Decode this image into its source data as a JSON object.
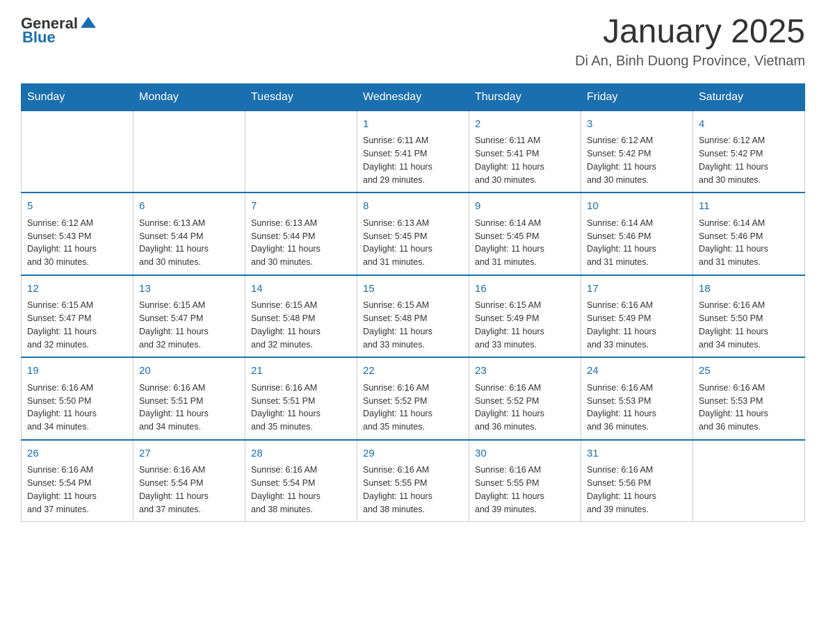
{
  "header": {
    "logo_general": "General",
    "logo_blue": "Blue",
    "month_title": "January 2025",
    "location": "Di An, Binh Duong Province, Vietnam"
  },
  "weekdays": [
    "Sunday",
    "Monday",
    "Tuesday",
    "Wednesday",
    "Thursday",
    "Friday",
    "Saturday"
  ],
  "weeks": [
    [
      {
        "day": "",
        "info": ""
      },
      {
        "day": "",
        "info": ""
      },
      {
        "day": "",
        "info": ""
      },
      {
        "day": "1",
        "info": "Sunrise: 6:11 AM\nSunset: 5:41 PM\nDaylight: 11 hours\nand 29 minutes."
      },
      {
        "day": "2",
        "info": "Sunrise: 6:11 AM\nSunset: 5:41 PM\nDaylight: 11 hours\nand 30 minutes."
      },
      {
        "day": "3",
        "info": "Sunrise: 6:12 AM\nSunset: 5:42 PM\nDaylight: 11 hours\nand 30 minutes."
      },
      {
        "day": "4",
        "info": "Sunrise: 6:12 AM\nSunset: 5:42 PM\nDaylight: 11 hours\nand 30 minutes."
      }
    ],
    [
      {
        "day": "5",
        "info": "Sunrise: 6:12 AM\nSunset: 5:43 PM\nDaylight: 11 hours\nand 30 minutes."
      },
      {
        "day": "6",
        "info": "Sunrise: 6:13 AM\nSunset: 5:44 PM\nDaylight: 11 hours\nand 30 minutes."
      },
      {
        "day": "7",
        "info": "Sunrise: 6:13 AM\nSunset: 5:44 PM\nDaylight: 11 hours\nand 30 minutes."
      },
      {
        "day": "8",
        "info": "Sunrise: 6:13 AM\nSunset: 5:45 PM\nDaylight: 11 hours\nand 31 minutes."
      },
      {
        "day": "9",
        "info": "Sunrise: 6:14 AM\nSunset: 5:45 PM\nDaylight: 11 hours\nand 31 minutes."
      },
      {
        "day": "10",
        "info": "Sunrise: 6:14 AM\nSunset: 5:46 PM\nDaylight: 11 hours\nand 31 minutes."
      },
      {
        "day": "11",
        "info": "Sunrise: 6:14 AM\nSunset: 5:46 PM\nDaylight: 11 hours\nand 31 minutes."
      }
    ],
    [
      {
        "day": "12",
        "info": "Sunrise: 6:15 AM\nSunset: 5:47 PM\nDaylight: 11 hours\nand 32 minutes."
      },
      {
        "day": "13",
        "info": "Sunrise: 6:15 AM\nSunset: 5:47 PM\nDaylight: 11 hours\nand 32 minutes."
      },
      {
        "day": "14",
        "info": "Sunrise: 6:15 AM\nSunset: 5:48 PM\nDaylight: 11 hours\nand 32 minutes."
      },
      {
        "day": "15",
        "info": "Sunrise: 6:15 AM\nSunset: 5:48 PM\nDaylight: 11 hours\nand 33 minutes."
      },
      {
        "day": "16",
        "info": "Sunrise: 6:15 AM\nSunset: 5:49 PM\nDaylight: 11 hours\nand 33 minutes."
      },
      {
        "day": "17",
        "info": "Sunrise: 6:16 AM\nSunset: 5:49 PM\nDaylight: 11 hours\nand 33 minutes."
      },
      {
        "day": "18",
        "info": "Sunrise: 6:16 AM\nSunset: 5:50 PM\nDaylight: 11 hours\nand 34 minutes."
      }
    ],
    [
      {
        "day": "19",
        "info": "Sunrise: 6:16 AM\nSunset: 5:50 PM\nDaylight: 11 hours\nand 34 minutes."
      },
      {
        "day": "20",
        "info": "Sunrise: 6:16 AM\nSunset: 5:51 PM\nDaylight: 11 hours\nand 34 minutes."
      },
      {
        "day": "21",
        "info": "Sunrise: 6:16 AM\nSunset: 5:51 PM\nDaylight: 11 hours\nand 35 minutes."
      },
      {
        "day": "22",
        "info": "Sunrise: 6:16 AM\nSunset: 5:52 PM\nDaylight: 11 hours\nand 35 minutes."
      },
      {
        "day": "23",
        "info": "Sunrise: 6:16 AM\nSunset: 5:52 PM\nDaylight: 11 hours\nand 36 minutes."
      },
      {
        "day": "24",
        "info": "Sunrise: 6:16 AM\nSunset: 5:53 PM\nDaylight: 11 hours\nand 36 minutes."
      },
      {
        "day": "25",
        "info": "Sunrise: 6:16 AM\nSunset: 5:53 PM\nDaylight: 11 hours\nand 36 minutes."
      }
    ],
    [
      {
        "day": "26",
        "info": "Sunrise: 6:16 AM\nSunset: 5:54 PM\nDaylight: 11 hours\nand 37 minutes."
      },
      {
        "day": "27",
        "info": "Sunrise: 6:16 AM\nSunset: 5:54 PM\nDaylight: 11 hours\nand 37 minutes."
      },
      {
        "day": "28",
        "info": "Sunrise: 6:16 AM\nSunset: 5:54 PM\nDaylight: 11 hours\nand 38 minutes."
      },
      {
        "day": "29",
        "info": "Sunrise: 6:16 AM\nSunset: 5:55 PM\nDaylight: 11 hours\nand 38 minutes."
      },
      {
        "day": "30",
        "info": "Sunrise: 6:16 AM\nSunset: 5:55 PM\nDaylight: 11 hours\nand 39 minutes."
      },
      {
        "day": "31",
        "info": "Sunrise: 6:16 AM\nSunset: 5:56 PM\nDaylight: 11 hours\nand 39 minutes."
      },
      {
        "day": "",
        "info": ""
      }
    ]
  ]
}
